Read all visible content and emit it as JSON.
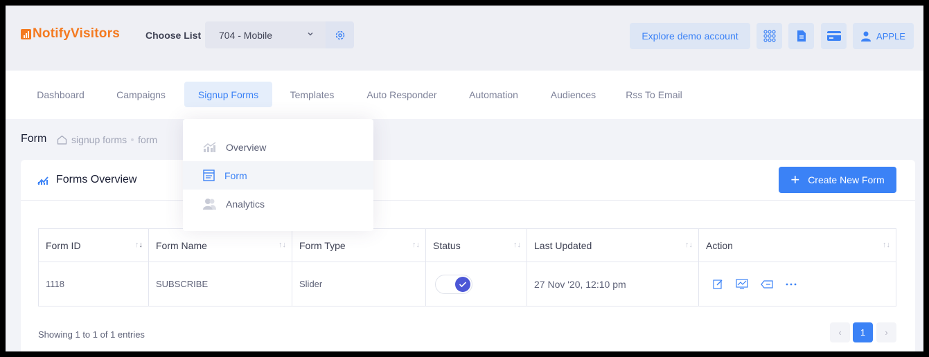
{
  "header": {
    "logo_text": "NotifyVisitors",
    "choose_list_label": "Choose List",
    "selected_list": "704 - Mobile",
    "demo_button": "Explore demo account",
    "user_button": "APPLE",
    "brand_color": "#f47a20",
    "accent_color": "#3b82f6"
  },
  "nav": {
    "items": [
      {
        "label": "Dashboard"
      },
      {
        "label": "Campaigns"
      },
      {
        "label": "Signup Forms"
      },
      {
        "label": "Templates"
      },
      {
        "label": "Auto Responder"
      },
      {
        "label": "Automation"
      },
      {
        "label": "Audiences"
      },
      {
        "label": "Rss To Email"
      }
    ],
    "active": "Signup Forms"
  },
  "dropdown": {
    "items": [
      {
        "label": "Overview",
        "icon": "chart-icon"
      },
      {
        "label": "Form",
        "icon": "form-icon"
      },
      {
        "label": "Analytics",
        "icon": "users-icon"
      }
    ],
    "active": "Form"
  },
  "breadcrumb": {
    "title": "Form",
    "path": [
      "signup forms",
      "form"
    ]
  },
  "card": {
    "title": "Forms Overview",
    "create_button": "Create New Form"
  },
  "table": {
    "columns": [
      "Form ID",
      "Form Name",
      "Form Type",
      "Status",
      "Last Updated",
      "Action"
    ],
    "rows": [
      {
        "id": "1118",
        "name": "SUBSCRIBE",
        "type": "Slider",
        "status": true,
        "updated": "27 Nov '20, 12:10 pm"
      }
    ],
    "footer": "Showing 1 to 1 of 1 entries",
    "current_page": "1"
  }
}
